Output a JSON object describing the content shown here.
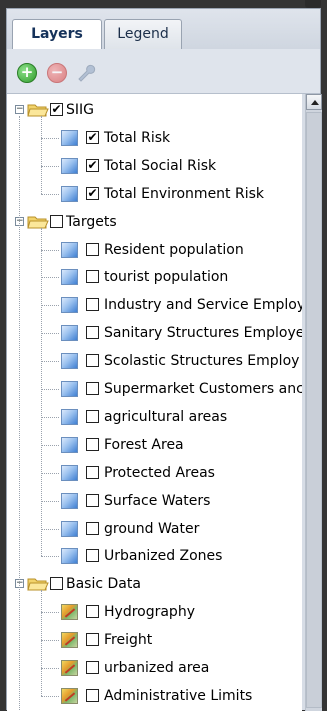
{
  "tabs": {
    "layers": "Layers",
    "legend": "Legend"
  },
  "toolbar": {
    "add_icon": "add-icon",
    "remove_icon": "remove-icon",
    "properties_icon": "wrench-icon"
  },
  "groups": [
    {
      "label": "SIIG",
      "checked": true,
      "expanded": true,
      "layers": [
        {
          "label": "Total Risk",
          "checked": true,
          "icon": "blue-layer-icon"
        },
        {
          "label": "Total Social Risk",
          "checked": true,
          "icon": "blue-layer-icon"
        },
        {
          "label": "Total Environment Risk",
          "checked": true,
          "icon": "blue-layer-icon"
        }
      ]
    },
    {
      "label": "Targets",
      "checked": false,
      "expanded": true,
      "layers": [
        {
          "label": "Resident population",
          "checked": false,
          "icon": "blue-layer-icon"
        },
        {
          "label": "tourist population",
          "checked": false,
          "icon": "blue-layer-icon"
        },
        {
          "label": "Industry and Service Employ",
          "checked": false,
          "icon": "blue-layer-icon"
        },
        {
          "label": "Sanitary Structures Employe",
          "checked": false,
          "icon": "blue-layer-icon"
        },
        {
          "label": "Scolastic Structures Employ",
          "checked": false,
          "icon": "blue-layer-icon"
        },
        {
          "label": "Supermarket Customers anc",
          "checked": false,
          "icon": "blue-layer-icon"
        },
        {
          "label": "agricultural areas",
          "checked": false,
          "icon": "blue-layer-icon"
        },
        {
          "label": "Forest Area",
          "checked": false,
          "icon": "blue-layer-icon"
        },
        {
          "label": "Protected Areas",
          "checked": false,
          "icon": "blue-layer-icon"
        },
        {
          "label": "Surface Waters",
          "checked": false,
          "icon": "blue-layer-icon"
        },
        {
          "label": "ground Water",
          "checked": false,
          "icon": "blue-layer-icon"
        },
        {
          "label": "Urbanized Zones",
          "checked": false,
          "icon": "blue-layer-icon"
        }
      ]
    },
    {
      "label": "Basic Data",
      "checked": false,
      "expanded": true,
      "layers": [
        {
          "label": "Hydrography",
          "checked": false,
          "icon": "map-layer-icon"
        },
        {
          "label": "Freight",
          "checked": false,
          "icon": "map-layer-icon"
        },
        {
          "label": "urbanized area",
          "checked": false,
          "icon": "map-layer-icon"
        },
        {
          "label": "Administrative Limits",
          "checked": false,
          "icon": "map-layer-icon"
        }
      ]
    }
  ],
  "colors": {
    "background": "#343434",
    "panel": "#d7dde6",
    "tab_text": "#15325a"
  }
}
